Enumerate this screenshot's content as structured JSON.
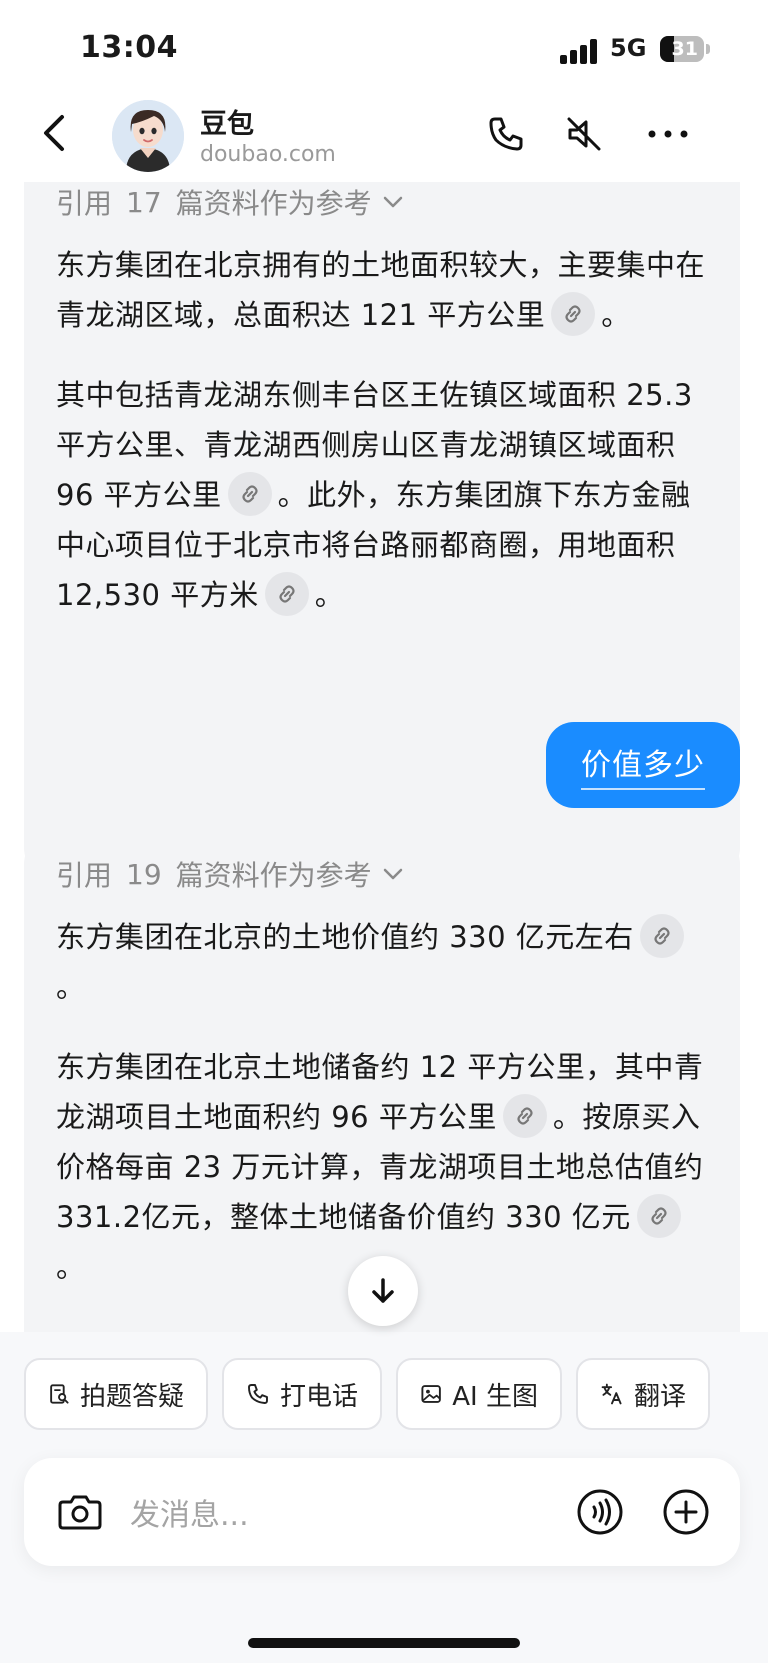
{
  "status_bar": {
    "time": "13:04",
    "network": "5G",
    "battery": "31",
    "battery_level": 0.31
  },
  "header": {
    "title": "豆包",
    "subtitle": "doubao.com",
    "icons": [
      "back-arrow-icon",
      "phone-icon",
      "mute-icon",
      "more-icon"
    ]
  },
  "messages": [
    {
      "role": "assistant",
      "ref_prefix": "引用",
      "ref_count": "17",
      "ref_suffix": "篇资料作为参考",
      "paragraphs": [
        {
          "segments": [
            "东方集团在北京拥有的土地面积较大，主要集中在青龙湖区域，总面积达 121 平方公里",
            "。"
          ]
        },
        {
          "segments": [
            "其中包括青龙湖东侧丰台区王佐镇区域面积 25.3 平方公里、青龙湖西侧房山区青龙湖镇区域面积 96 平方公里",
            "。此外，东方集团旗下东方金融中心项目位于北京市将台路丽都商圈，用地面积 12,530 平方米",
            "。"
          ]
        }
      ]
    },
    {
      "role": "user",
      "text": "价值多少"
    },
    {
      "role": "assistant",
      "ref_prefix": "引用",
      "ref_count": "19",
      "ref_suffix": "篇资料作为参考",
      "paragraphs": [
        {
          "segments": [
            "东方集团在北京的土地价值约 330 亿元左右",
            "。"
          ]
        },
        {
          "segments": [
            "东方集团在北京土地储备约 12 平方公里，其中青龙湖项目土地面积约 96 平方公里",
            "。按原买入价格每亩 23 万元计算，青龙湖项目土地总估值约 331.2亿元，整体土地储备价值约 330 亿元",
            "。"
          ]
        }
      ]
    }
  ],
  "quick_actions": [
    {
      "label": "拍题答疑",
      "icon": "photo-search-icon"
    },
    {
      "label": "打电话",
      "icon": "phone-icon"
    },
    {
      "label": "AI 生图",
      "icon": "image-icon"
    },
    {
      "label": "翻译",
      "icon": "translate-icon"
    }
  ],
  "input": {
    "placeholder": "发消息..."
  },
  "colors": {
    "accent": "#1a8cff",
    "bubble": "#f3f4f6",
    "muted": "#8a8a8a"
  }
}
